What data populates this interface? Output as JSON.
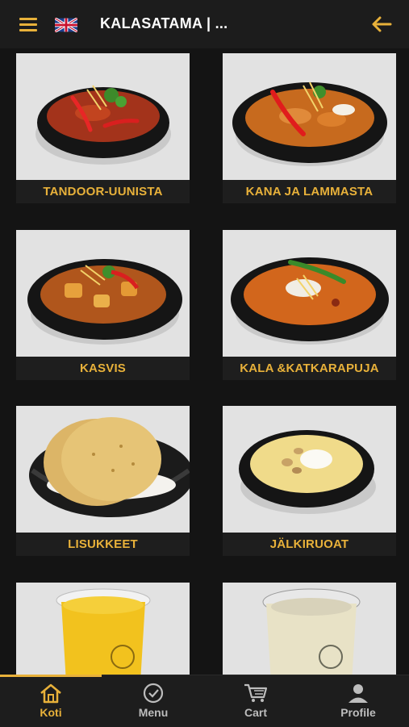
{
  "header": {
    "title": "KALASATAMA | ...",
    "menu_icon": "hamburger-menu-icon",
    "language_icon": "uk-flag-icon",
    "back_icon": "arrow-left-icon"
  },
  "categories": [
    {
      "label": "TANDOOR-UUNISTA",
      "image": "tandoori-dish"
    },
    {
      "label": "KANA JA LAMMASTA",
      "image": "chicken-lamb-curry"
    },
    {
      "label": "KASVIS",
      "image": "vegetable-curry"
    },
    {
      "label": "KALA &KATKARAPUJA",
      "image": "fish-shrimp-curry"
    },
    {
      "label": "LISUKKEET",
      "image": "papadum-basket"
    },
    {
      "label": "JÄLKIRUOAT",
      "image": "kheer-dessert"
    },
    {
      "label": "",
      "image": "mango-lassi-cup"
    },
    {
      "label": "",
      "image": "lassi-cup"
    }
  ],
  "bottom_nav": [
    {
      "label": "Koti",
      "icon": "home-icon",
      "active": true
    },
    {
      "label": "Menu",
      "icon": "check-circle-icon",
      "active": false
    },
    {
      "label": "Cart",
      "icon": "cart-icon",
      "active": false
    },
    {
      "label": "Profile",
      "icon": "profile-icon",
      "active": false
    }
  ],
  "colors": {
    "accent": "#e8b13a",
    "background": "#141414",
    "header": "#1c1c1c"
  }
}
